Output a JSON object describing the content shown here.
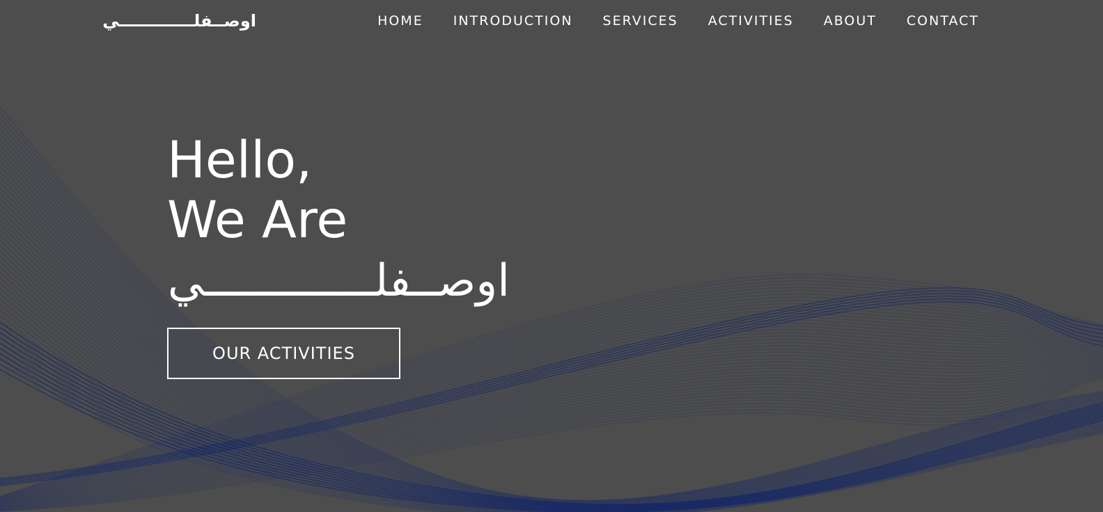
{
  "page": {
    "background_color": "#4d4d4d",
    "wave_color": "#0a1f6e"
  },
  "header": {
    "brand": "اوصــفلـــــــــــــي"
  },
  "nav": {
    "items": [
      {
        "label": "HOME"
      },
      {
        "label": "INTRODUCTION"
      },
      {
        "label": "SERVICES"
      },
      {
        "label": "ACTIVITIES"
      },
      {
        "label": "ABOUT"
      },
      {
        "label": "CONTACT"
      }
    ]
  },
  "hero": {
    "line1": "Hello,",
    "line2": "We Are",
    "line3": "اوصــفلـــــــــــــي",
    "cta_label": "OUR ACTIVITIES"
  }
}
